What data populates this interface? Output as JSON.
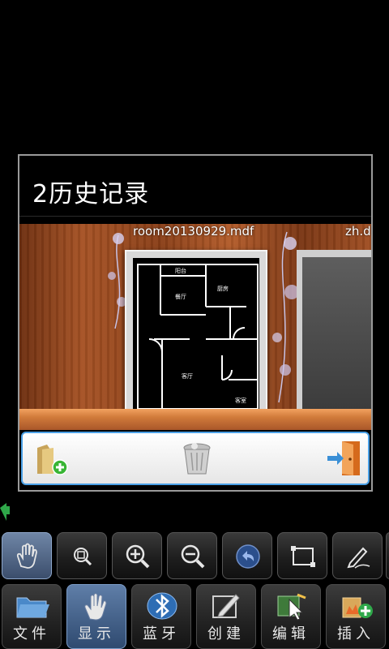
{
  "dialog": {
    "title": "2历史记录",
    "files": [
      {
        "name": "room20130929.mdf"
      },
      {
        "name": "zh.d"
      }
    ],
    "actions": [
      {
        "icon": "add-folder-icon"
      },
      {
        "icon": "trash-icon"
      },
      {
        "icon": "exit-door-icon"
      }
    ]
  },
  "toolbar": {
    "tools": [
      {
        "icon": "hand-pan-icon",
        "active": true
      },
      {
        "icon": "zoom-fit-icon"
      },
      {
        "icon": "zoom-in-icon"
      },
      {
        "icon": "zoom-out-icon"
      },
      {
        "icon": "undo-icon"
      },
      {
        "icon": "rectangle-select-icon"
      },
      {
        "icon": "pen-draw-icon"
      }
    ]
  },
  "menu": {
    "items": [
      {
        "label": "文件",
        "icon": "file-folder-icon"
      },
      {
        "label": "显示",
        "icon": "hand-display-icon",
        "active": true
      },
      {
        "label": "蓝牙",
        "icon": "bluetooth-icon"
      },
      {
        "label": "创建",
        "icon": "create-edit-icon"
      },
      {
        "label": "编辑",
        "icon": "edit-cursor-icon"
      },
      {
        "label": "插入",
        "icon": "insert-add-icon"
      }
    ]
  }
}
